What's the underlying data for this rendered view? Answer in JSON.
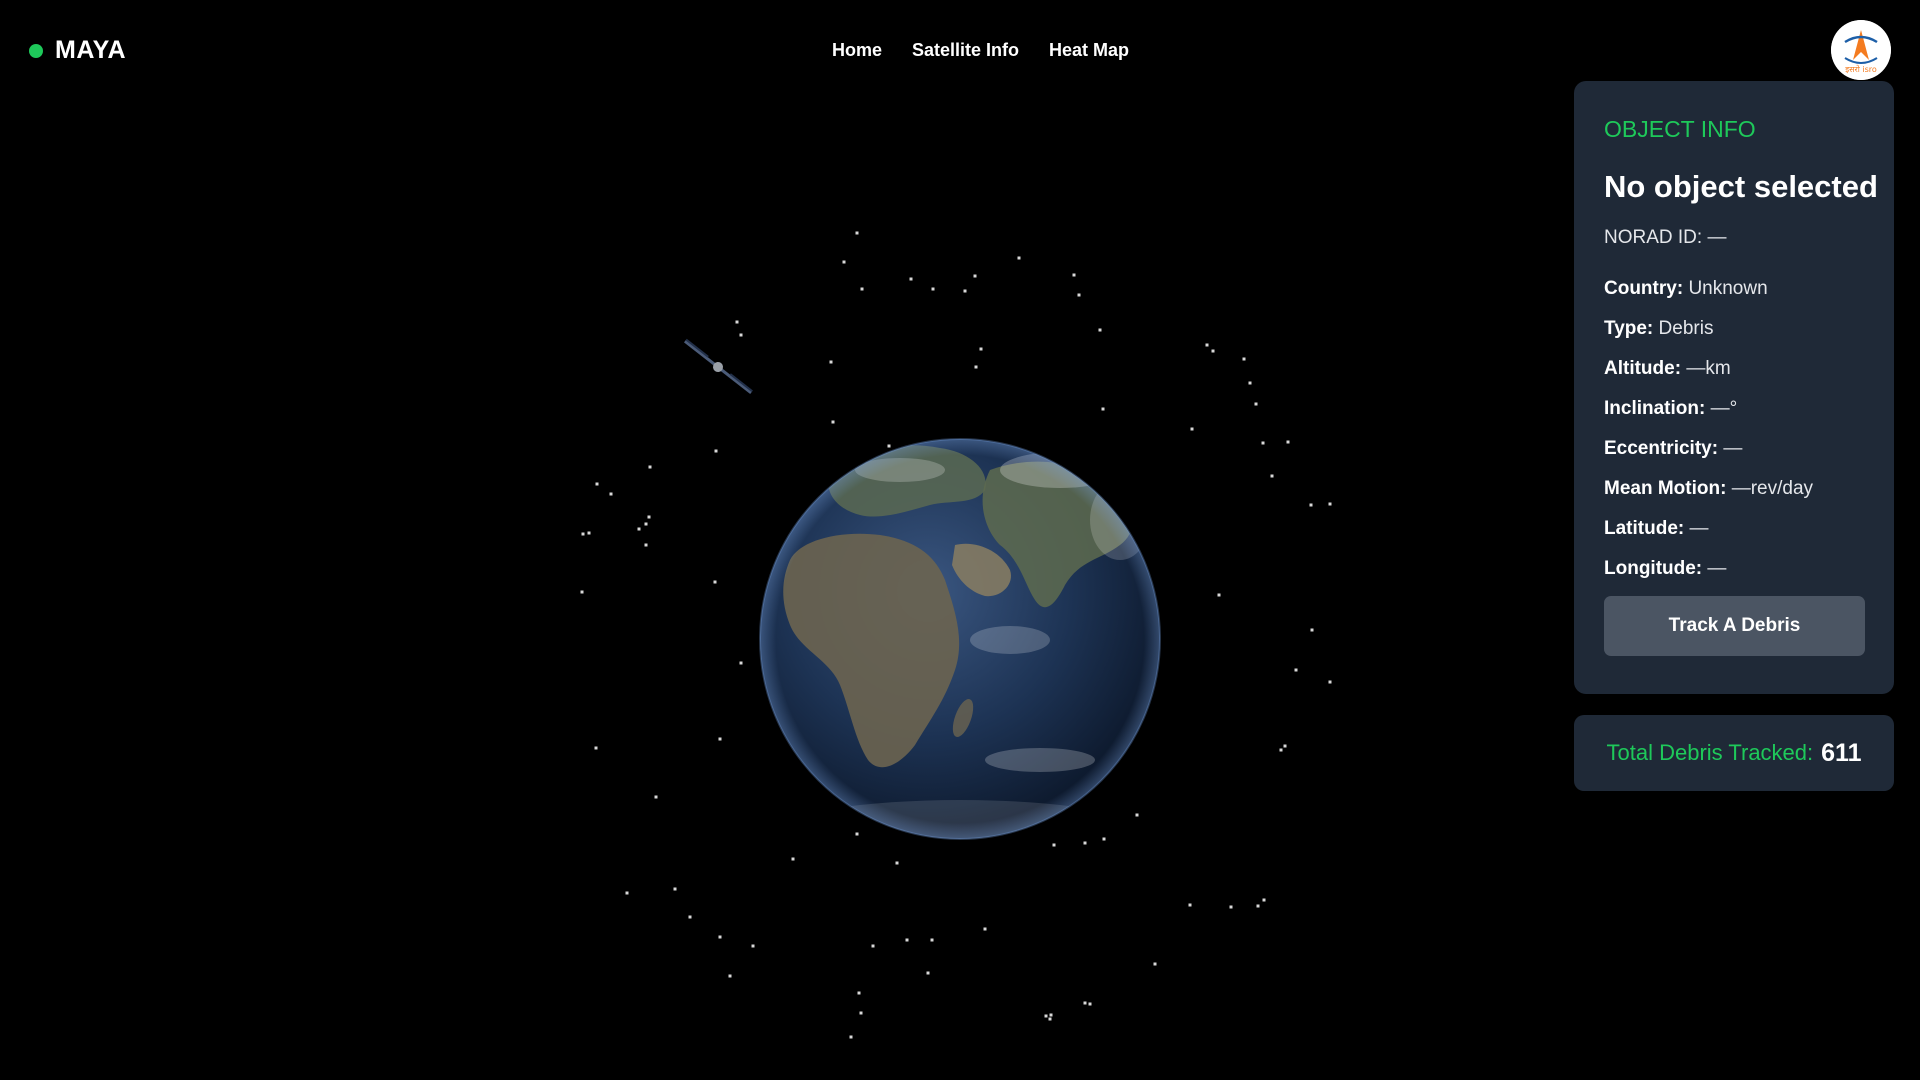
{
  "brand": {
    "name": "MAYA",
    "status_color": "#1ec95a"
  },
  "nav": {
    "items": [
      {
        "label": "Home"
      },
      {
        "label": "Satellite Info"
      },
      {
        "label": "Heat Map"
      }
    ]
  },
  "logo": {
    "icon": "isro-logo-icon",
    "text": "इसरो isro"
  },
  "object_info": {
    "heading": "OBJECT INFO",
    "title": "No object selected",
    "norad_label": "NORAD ID:",
    "norad_value": "—",
    "fields": [
      {
        "key": "Country:",
        "value": "Unknown"
      },
      {
        "key": "Type:",
        "value": "Debris"
      },
      {
        "key": "Altitude:",
        "value": "—km"
      },
      {
        "key": "Inclination:",
        "value": "—°"
      },
      {
        "key": "Eccentricity:",
        "value": "—"
      },
      {
        "key": "Mean Motion:",
        "value": "—rev/day"
      },
      {
        "key": "Latitude:",
        "value": "—"
      },
      {
        "key": "Longitude:",
        "value": "—"
      }
    ],
    "track_button": "Track A Debris"
  },
  "total": {
    "label": "Total Debris Tracked:",
    "value": "611"
  },
  "scene": {
    "globe_icon": "earth-globe-icon",
    "satellite_icon": "satellite-icon",
    "accent_color": "#1ec95a",
    "panel_color": "#1f2937",
    "button_color": "#4b5563"
  }
}
